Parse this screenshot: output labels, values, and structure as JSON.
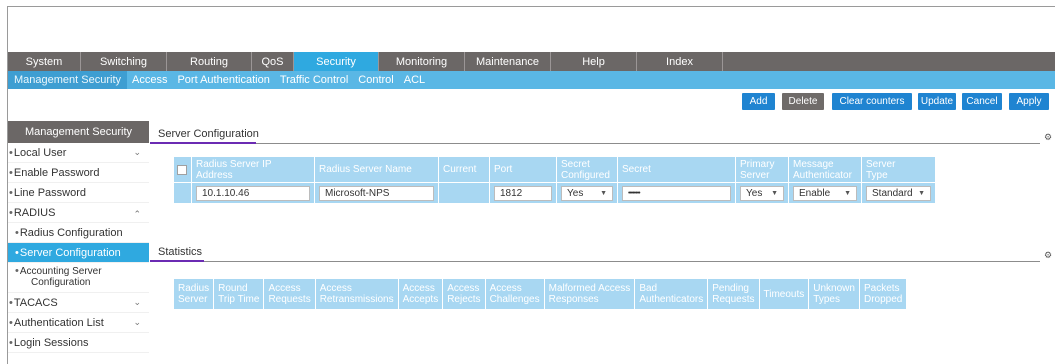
{
  "main_nav": {
    "tabs": [
      {
        "label": "System",
        "active": false
      },
      {
        "label": "Switching",
        "active": false
      },
      {
        "label": "Routing",
        "active": false
      },
      {
        "label": "QoS",
        "active": false
      },
      {
        "label": "Security",
        "active": true
      },
      {
        "label": "Monitoring",
        "active": false
      },
      {
        "label": "Maintenance",
        "active": false
      },
      {
        "label": "Help",
        "active": false
      },
      {
        "label": "Index",
        "active": false
      }
    ]
  },
  "sub_nav": {
    "tabs": [
      {
        "label": "Management Security",
        "active": true
      },
      {
        "label": "Access",
        "active": false
      },
      {
        "label": "Port Authentication",
        "active": false
      },
      {
        "label": "Traffic Control",
        "active": false
      },
      {
        "label": "Control",
        "active": false
      },
      {
        "label": "ACL",
        "active": false
      }
    ]
  },
  "actions": {
    "add": "Add",
    "delete": "Delete",
    "clear_counters": "Clear counters",
    "update": "Update",
    "cancel": "Cancel",
    "apply": "Apply"
  },
  "sidebar": {
    "title": "Management Security",
    "items": [
      {
        "label": "Local User",
        "chevron": "down"
      },
      {
        "label": "Enable Password"
      },
      {
        "label": "Line Password"
      },
      {
        "label": "RADIUS",
        "chevron": "up"
      },
      {
        "label": "Radius Configuration",
        "sub": true
      },
      {
        "label": "Server Configuration",
        "sub": true,
        "selected": true
      },
      {
        "label": "Accounting Server",
        "label2": "Configuration",
        "sub": true
      },
      {
        "label": "TACACS",
        "chevron": "down"
      },
      {
        "label": "Authentication List",
        "chevron": "down"
      },
      {
        "label": "Login Sessions"
      }
    ]
  },
  "server_config": {
    "title": "Server Configuration",
    "headers": {
      "ip": "Radius Server IP Address",
      "name": "Radius Server Name",
      "current": "Current",
      "port": "Port",
      "secret_configured_1": "Secret",
      "secret_configured_2": "Configured",
      "secret": "Secret",
      "primary_1": "Primary",
      "primary_2": "Server",
      "msg_auth_1": "Message",
      "msg_auth_2": "Authenticator",
      "server_type_1": "Server",
      "server_type_2": "Type"
    },
    "row": {
      "ip": "10.1.10.46",
      "name": "Microsoft-NPS",
      "current": "",
      "port": "1812",
      "secret_configured": "Yes",
      "secret": "••••••••",
      "primary": "Yes",
      "msg_auth": "Enable",
      "server_type": "Standard"
    }
  },
  "statistics": {
    "title": "Statistics",
    "columns": [
      [
        "Radius",
        "Server"
      ],
      [
        "Round",
        "Trip Time"
      ],
      [
        "Access",
        "Requests"
      ],
      [
        "Access",
        "Retransmissions"
      ],
      [
        "Access",
        "Accepts"
      ],
      [
        "Access",
        "Rejects"
      ],
      [
        "Access",
        "Challenges"
      ],
      [
        "Malformed Access",
        "Responses"
      ],
      [
        "Bad",
        "Authenticators"
      ],
      [
        "Pending",
        "Requests"
      ],
      [
        "Timeouts",
        ""
      ],
      [
        "Unknown",
        "Types"
      ],
      [
        "Packets",
        "Dropped"
      ]
    ]
  },
  "colors": {
    "nav_bg": "#6b6766",
    "accent": "#2fa9e0",
    "subnav_bg": "#5ab7e5",
    "table_bg": "#a8d7f2",
    "section_underline": "#6b2bb3",
    "button_blue": "#1f84d1"
  },
  "icons": {
    "section_settings": "gear-icon"
  }
}
